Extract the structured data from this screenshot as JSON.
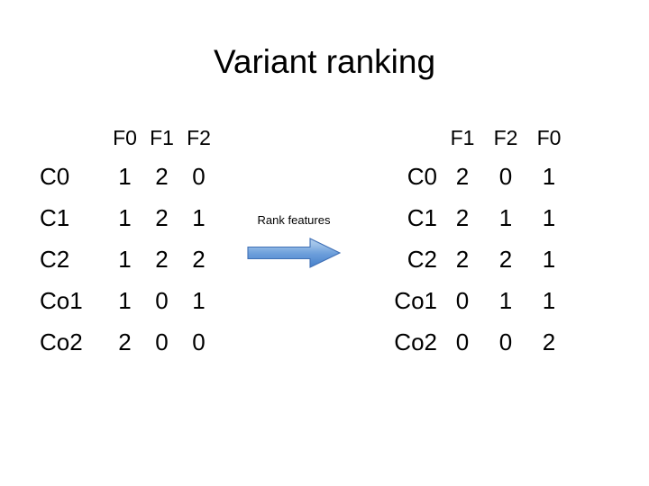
{
  "slide": {
    "title": "Variant ranking",
    "background_color": "#ffffff",
    "text_color": "#000000"
  },
  "left_table": {
    "name": "original-feature-matrix",
    "corner_label": "",
    "columns": [
      "F0",
      "F1",
      "F2"
    ],
    "rows": [
      {
        "label": "C0",
        "values": [
          "1",
          "2",
          "0"
        ]
      },
      {
        "label": "C1",
        "values": [
          "1",
          "2",
          "1"
        ]
      },
      {
        "label": "C2",
        "values": [
          "1",
          "2",
          "2"
        ]
      },
      {
        "label": "Co1",
        "values": [
          "1",
          "0",
          "1"
        ]
      },
      {
        "label": "Co2",
        "values": [
          "2",
          "0",
          "0"
        ]
      }
    ]
  },
  "arrow": {
    "label": "Rank features",
    "direction": "right",
    "fill_top_color": "#a8c8ec",
    "fill_mid_color": "#6d9fdb",
    "fill_bottom_color": "#4f86ce",
    "outline_color": "#3f6fb5"
  },
  "right_table": {
    "name": "ranked-feature-matrix",
    "corner_label": "",
    "columns": [
      "F1",
      "F2",
      "F0"
    ],
    "rows": [
      {
        "label": "C0",
        "values": [
          "2",
          "0",
          "1"
        ]
      },
      {
        "label": "C1",
        "values": [
          "2",
          "1",
          "1"
        ]
      },
      {
        "label": "C2",
        "values": [
          "2",
          "2",
          "1"
        ]
      },
      {
        "label": "Co1",
        "values": [
          "0",
          "1",
          "1"
        ]
      },
      {
        "label": "Co2",
        "values": [
          "0",
          "0",
          "2"
        ]
      }
    ]
  }
}
